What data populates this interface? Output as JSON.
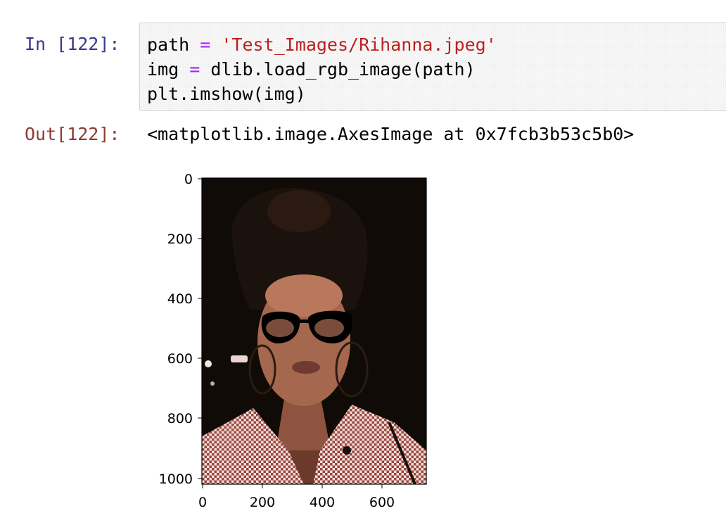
{
  "cell": {
    "in_prompt": "In [122]:",
    "out_prompt": "Out[122]:",
    "code": {
      "line1": {
        "var": "path",
        "op": "=",
        "string": "'Test_Images/Rihanna.jpeg'"
      },
      "line2": {
        "var": "img",
        "op": "=",
        "call": "dlib.load_rgb_image(path)"
      },
      "line3": "plt.imshow(img)"
    },
    "output_repr": "<matplotlib.image.AxesImage at 0x7fcb3b53c5b0>"
  },
  "plot": {
    "image_subject": "portrait photo of a woman with black cat-eye glasses, hoop earrings and a red-and-white houndstooth jacket",
    "x_ticks": [
      "0",
      "200",
      "400",
      "600"
    ],
    "y_ticks": [
      "0",
      "200",
      "400",
      "600",
      "800",
      "1000"
    ],
    "colors": {
      "background": "#100b06",
      "skin": "#a5674e",
      "hair": "#1c120d",
      "jacket_red": "#9a463f",
      "jacket_white": "#f0dfd8"
    }
  }
}
